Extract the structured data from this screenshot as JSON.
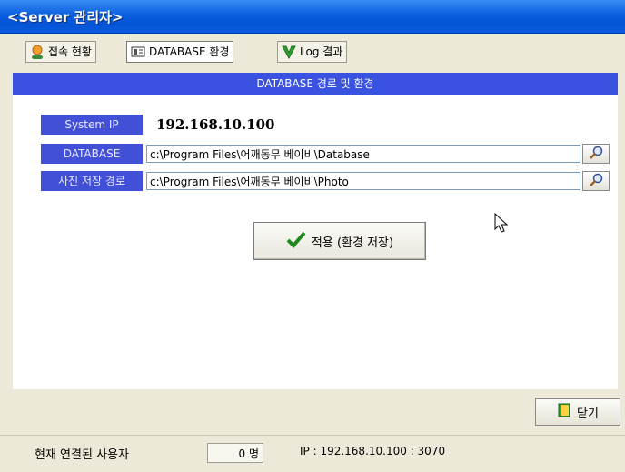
{
  "window": {
    "title": "<Server 관리자>"
  },
  "tabs": [
    {
      "label": "접속 현황",
      "icon": "users-icon"
    },
    {
      "label": "DATABASE 환경",
      "icon": "database-icon"
    },
    {
      "label": "Log 결과",
      "icon": "log-check-icon"
    }
  ],
  "section": {
    "title": "DATABASE 경로 및 환경"
  },
  "form": {
    "system_ip_label": "System IP",
    "system_ip_value": "192.168.10.100",
    "database_label": "DATABASE",
    "database_path": "c:\\Program Files\\어깨동무 베이비\\Database",
    "photo_label": "사진 저장 경로",
    "photo_path": "c:\\Program Files\\어깨동무 베이비\\Photo"
  },
  "buttons": {
    "apply_label": "적용 (환경 저장)",
    "close_label": "닫기"
  },
  "status": {
    "connected_users_label": "현재 연결된 사용자",
    "connected_users_count": "0 명",
    "ip_info": "IP : 192.168.10.100 : 3070"
  },
  "colors": {
    "title_bar": "#0a5fe0",
    "section_header": "#3a52e0",
    "label_bg": "#4250d8",
    "window_bg": "#ece9d8"
  }
}
